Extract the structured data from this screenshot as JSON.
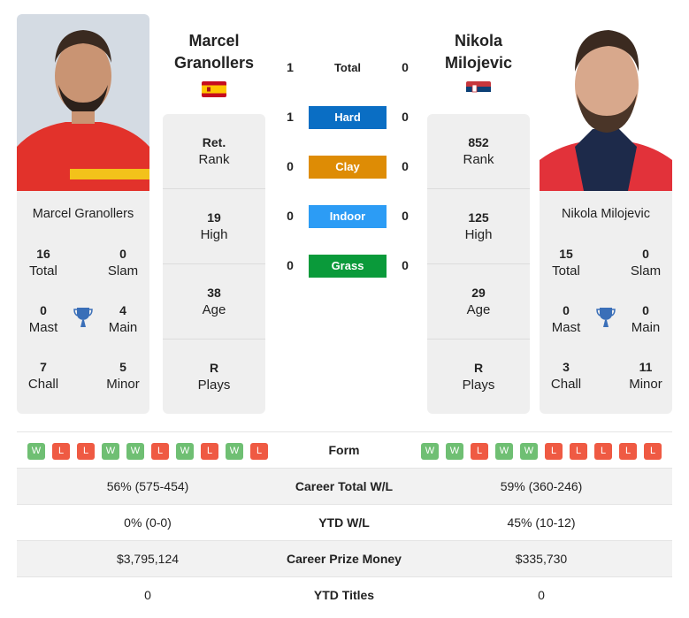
{
  "player1": {
    "name_line1": "Marcel",
    "name_line2": "Granollers",
    "full_name": "Marcel Granollers",
    "country": "Spain",
    "flag_icon": "spain-flag-icon",
    "info": [
      {
        "value": "Ret.",
        "label": "Rank"
      },
      {
        "value": "19",
        "label": "High"
      },
      {
        "value": "38",
        "label": "Age"
      },
      {
        "value": "R",
        "label": "Plays"
      }
    ],
    "titles": {
      "total": {
        "value": "16",
        "label": "Total"
      },
      "slam": {
        "value": "0",
        "label": "Slam"
      },
      "mast": {
        "value": "0",
        "label": "Mast"
      },
      "main": {
        "value": "4",
        "label": "Main"
      },
      "chall": {
        "value": "7",
        "label": "Chall"
      },
      "minor": {
        "value": "5",
        "label": "Minor"
      }
    },
    "form": [
      "W",
      "L",
      "L",
      "W",
      "W",
      "L",
      "W",
      "L",
      "W",
      "L"
    ]
  },
  "player2": {
    "name_line1": "Nikola",
    "name_line2": "Milojevic",
    "full_name": "Nikola Milojevic",
    "country": "Serbia",
    "flag_icon": "serbia-flag-icon",
    "info": [
      {
        "value": "852",
        "label": "Rank"
      },
      {
        "value": "125",
        "label": "High"
      },
      {
        "value": "29",
        "label": "Age"
      },
      {
        "value": "R",
        "label": "Plays"
      }
    ],
    "titles": {
      "total": {
        "value": "15",
        "label": "Total"
      },
      "slam": {
        "value": "0",
        "label": "Slam"
      },
      "mast": {
        "value": "0",
        "label": "Mast"
      },
      "main": {
        "value": "0",
        "label": "Main"
      },
      "chall": {
        "value": "3",
        "label": "Chall"
      },
      "minor": {
        "value": "11",
        "label": "Minor"
      }
    },
    "form": [
      "W",
      "W",
      "L",
      "W",
      "W",
      "L",
      "L",
      "L",
      "L",
      "L"
    ]
  },
  "h2h": [
    {
      "label": "Total",
      "p1": "1",
      "p2": "0",
      "color": ""
    },
    {
      "label": "Hard",
      "p1": "1",
      "p2": "0",
      "color": "#0a6ec4"
    },
    {
      "label": "Clay",
      "p1": "0",
      "p2": "0",
      "color": "#de8c05"
    },
    {
      "label": "Indoor",
      "p1": "0",
      "p2": "0",
      "color": "#2c9cf5"
    },
    {
      "label": "Grass",
      "p1": "0",
      "p2": "0",
      "color": "#0a9a3a"
    }
  ],
  "form_label": "Form",
  "comparison": [
    {
      "label": "Career Total W/L",
      "p1": "56% (575-454)",
      "p2": "59% (360-246)"
    },
    {
      "label": "YTD W/L",
      "p1": "0% (0-0)",
      "p2": "45% (10-12)"
    },
    {
      "label": "Career Prize Money",
      "p1": "$3,795,124",
      "p2": "$335,730"
    },
    {
      "label": "YTD Titles",
      "p1": "0",
      "p2": "0"
    }
  ],
  "colors": {
    "win": "#6fbf73",
    "loss": "#ef5a43",
    "card_bg": "#efefef",
    "trophy": "#3a6fb8"
  }
}
